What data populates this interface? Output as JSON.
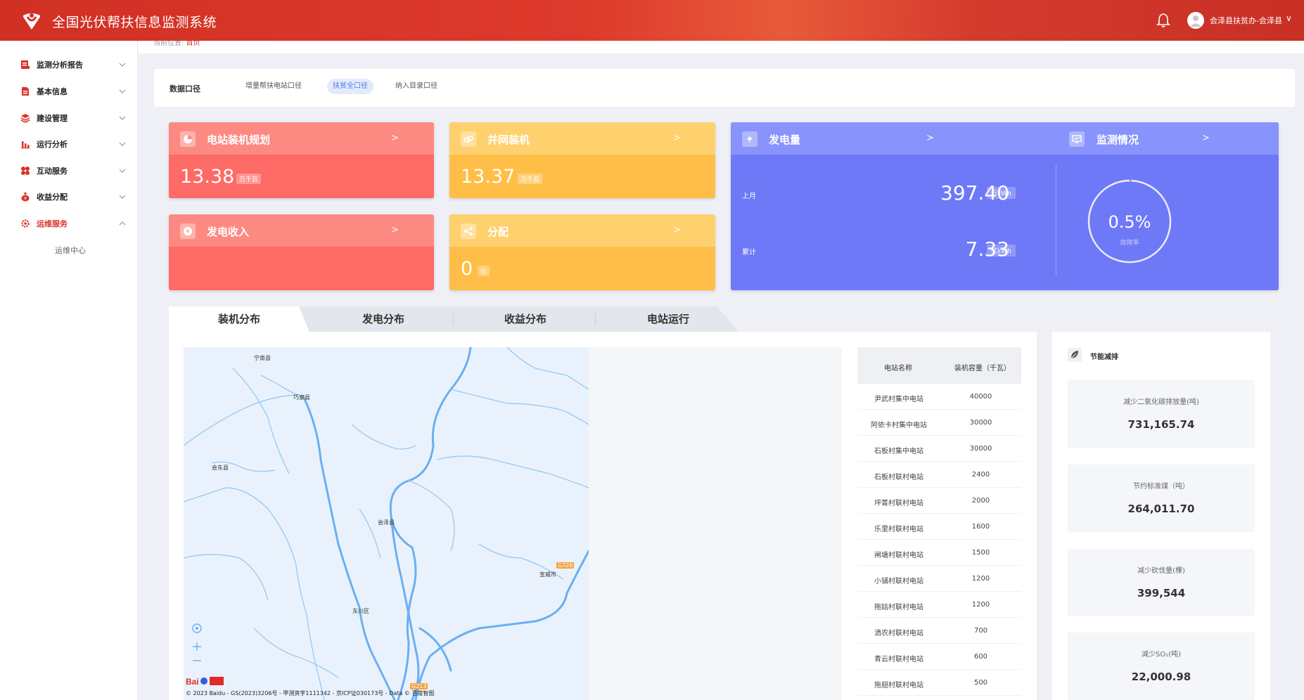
{
  "app": {
    "title": "全国光伏帮扶信息监测系统",
    "user_name": "会泽县扶贫办-会泽县",
    "caret": "∨"
  },
  "sidebar": {
    "items": [
      {
        "label": "监测分析报告",
        "icon": "report-icon"
      },
      {
        "label": "基本信息",
        "icon": "document-icon"
      },
      {
        "label": "建设管理",
        "icon": "layers-icon"
      },
      {
        "label": "运行分析",
        "icon": "bar-chart-icon"
      },
      {
        "label": "互动服务",
        "icon": "grid-icon"
      },
      {
        "label": "收益分配",
        "icon": "money-bag-icon"
      },
      {
        "label": "运维服务",
        "icon": "gear-icon",
        "active": true
      }
    ],
    "sub_item": "运维中心"
  },
  "breadcrumb": {
    "prefix": "当前位置:",
    "current": "首页"
  },
  "filter": {
    "label": "数据口径",
    "options": [
      "增量帮扶电站口径",
      "扶贫全口径",
      "纳入目录口径"
    ],
    "selected": "扶贫全口径"
  },
  "cards": {
    "plan": {
      "title": "电站装机规划",
      "arrow": ">",
      "value": "13.38",
      "unit": "万千瓦"
    },
    "grid": {
      "title": "并网装机",
      "arrow": ">",
      "value": "13.37",
      "unit": "万千瓦"
    },
    "income": {
      "title": "发电收入",
      "arrow": ">"
    },
    "distribution": {
      "title": "分配",
      "arrow": ">",
      "value": "0",
      "unit": "元"
    },
    "generation": {
      "title": "发电量",
      "arrow": ">",
      "last_month_label": "上月",
      "last_month_value": "397.40",
      "last_month_unit": "万kWh",
      "total_label": "累计",
      "total_value": "7.33",
      "total_unit": "亿kWh"
    },
    "monitor": {
      "title": "监测情况",
      "arrow": ">",
      "rate": "0.5%",
      "rate_label": "故障率",
      "rate_fraction": 0.005
    }
  },
  "tabs": [
    "装机分布",
    "发电分布",
    "收益分布",
    "电站运行"
  ],
  "active_tab": "装机分布",
  "map": {
    "labels": [
      "宁南县",
      "巧家县",
      "会东县",
      "会泽县",
      "东川区",
      "宣威市"
    ],
    "road_badges": [
      "G326",
      "G213"
    ],
    "baidu_logo": "Bai度地图",
    "copyright": "© 2023 Baidu - GS(2023)3206号 - 甲测资字1111342 - 京ICP证030173号 - Data © 百度智图"
  },
  "table": {
    "headers": [
      "电站名称",
      "装机容量（千瓦）"
    ],
    "rows": [
      [
        "尹武村集中电站",
        "40000"
      ],
      [
        "阿依卡村集中电站",
        "30000"
      ],
      [
        "石板村集中电站",
        "30000"
      ],
      [
        "石板村联村电站",
        "2400"
      ],
      [
        "坪箐村联村电站",
        "2000"
      ],
      [
        "乐里村联村电站",
        "1600"
      ],
      [
        "闸塘村联村电站",
        "1500"
      ],
      [
        "小铺村联村电站",
        "1200"
      ],
      [
        "拖姑村联村电站",
        "1200"
      ],
      [
        "洒农村联村电站",
        "700"
      ],
      [
        "青云村联村电站",
        "600"
      ],
      [
        "拖翅村联村电站",
        "500"
      ]
    ]
  },
  "eco": {
    "title": "节能减排",
    "items": [
      {
        "label": "减少二氧化碳排放量(吨)",
        "value": "731,165.74"
      },
      {
        "label": "节约标准煤（吨）",
        "value": "264,011.70"
      },
      {
        "label": "减少砍伐量(棵)",
        "value": "399,544"
      },
      {
        "label": "减少SO₂(吨)",
        "value": "22,000.98"
      }
    ]
  },
  "colors": {
    "header_red": "#d13024",
    "card_red": "#fe6a65",
    "card_yellow": "#ffbe47",
    "card_blue": "#6e79f7",
    "active_tab_blue": "#4d7be6"
  }
}
